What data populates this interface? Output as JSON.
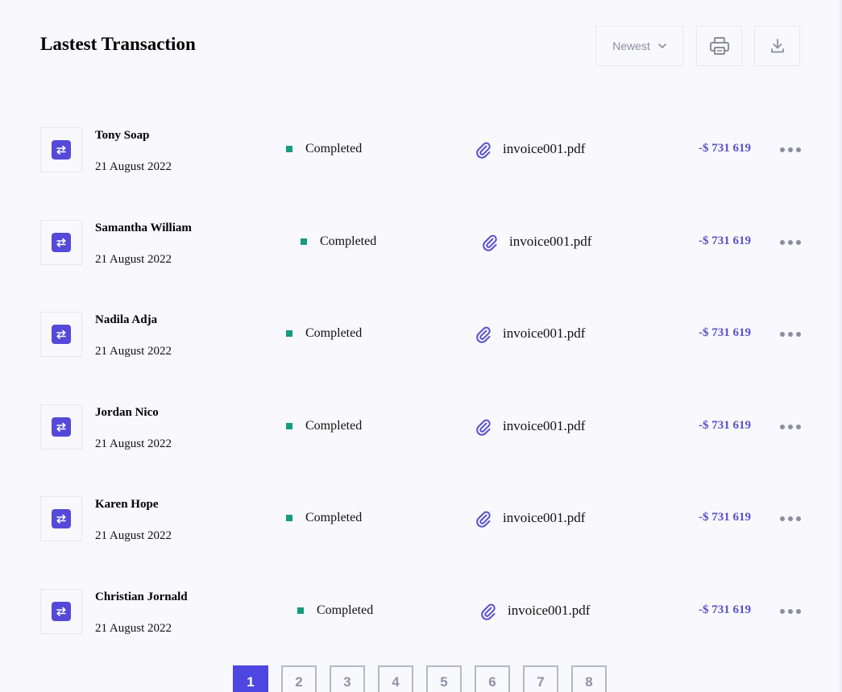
{
  "header": {
    "title": "Lastest Transaction",
    "sort_label": "Newest",
    "print_icon": "printer-icon",
    "download_icon": "download-icon"
  },
  "transactions": [
    {
      "name": "Tony Soap",
      "date": "21 August 2022",
      "status": "Completed",
      "file": "invoice001.pdf",
      "amount": "-$ 731 619"
    },
    {
      "name": "Samantha William",
      "date": "21 August 2022",
      "status": "Completed",
      "file": "invoice001.pdf",
      "amount": "-$ 731 619"
    },
    {
      "name": "Nadila Adja",
      "date": "21 August 2022",
      "status": "Completed",
      "file": "invoice001.pdf",
      "amount": "-$ 731 619"
    },
    {
      "name": "Jordan Nico",
      "date": "21 August 2022",
      "status": "Completed",
      "file": "invoice001.pdf",
      "amount": "-$ 731 619"
    },
    {
      "name": "Karen Hope",
      "date": "21 August 2022",
      "status": "Completed",
      "file": "invoice001.pdf",
      "amount": "-$ 731 619"
    },
    {
      "name": "Christian Jornald",
      "date": "21 August 2022",
      "status": "Completed",
      "file": "invoice001.pdf",
      "amount": "-$ 731 619"
    }
  ],
  "pagination": {
    "pages": [
      "1",
      "2",
      "3",
      "4",
      "5",
      "6",
      "7",
      "8"
    ],
    "current": "1"
  },
  "colors": {
    "accent": "#4d46e0",
    "icon_bg": "#5449d9",
    "amount": "#5a51c9",
    "status_completed": "#139c80",
    "background": "#f8f8fd"
  }
}
